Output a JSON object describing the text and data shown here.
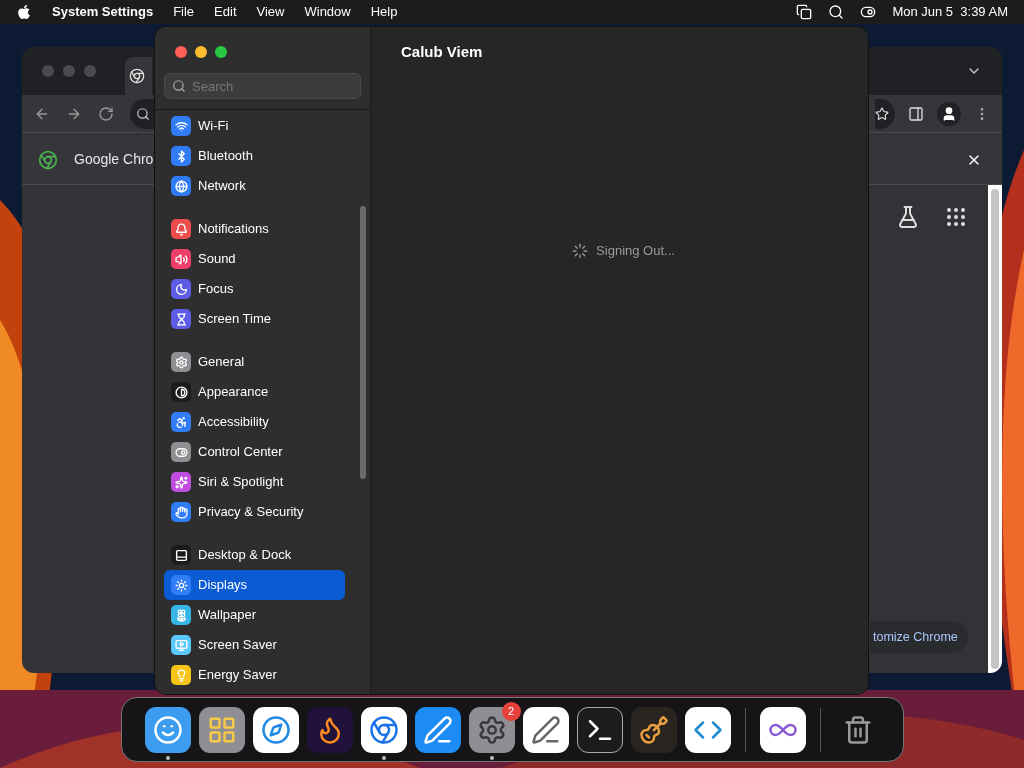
{
  "menu_bar": {
    "app_name": "System Settings",
    "menus": [
      "File",
      "Edit",
      "View",
      "Window",
      "Help"
    ],
    "clock": "Mon Jun 5  3:39 AM"
  },
  "browser_window": {
    "info_bar_text": "Google Chro",
    "customize_button": "tomize Chrome"
  },
  "settings_window": {
    "search": {
      "placeholder": "Search"
    },
    "sidebar_groups": [
      {
        "items": [
          {
            "label": "Wi-Fi",
            "kind": "wifi",
            "color": "#2f7cf6",
            "selected": false
          },
          {
            "label": "Bluetooth",
            "kind": "bluetooth",
            "color": "#2f7cf6",
            "selected": false
          },
          {
            "label": "Network",
            "kind": "globe",
            "color": "#2f7cf6",
            "selected": false
          }
        ]
      },
      {
        "items": [
          {
            "label": "Notifications",
            "kind": "bell",
            "color": "#ee4c4c",
            "selected": false
          },
          {
            "label": "Sound",
            "kind": "speaker",
            "color": "#ee3f6a",
            "selected": false
          },
          {
            "label": "Focus",
            "kind": "moon",
            "color": "#5e5ce6",
            "selected": false
          },
          {
            "label": "Screen Time",
            "kind": "hourglass",
            "color": "#5e5ce6",
            "selected": false
          }
        ]
      },
      {
        "items": [
          {
            "label": "General",
            "kind": "gear",
            "color": "#8e8e93",
            "selected": false
          },
          {
            "label": "Appearance",
            "kind": "contrast",
            "color": "#1c1c1e",
            "selected": false
          },
          {
            "label": "Accessibility",
            "kind": "accessibility",
            "color": "#2f7cf6",
            "selected": false
          },
          {
            "label": "Control Center",
            "kind": "toggles",
            "color": "#8e8e93",
            "selected": false
          },
          {
            "label": "Siri & Spotlight",
            "kind": "sparkles",
            "color": "#c04ce0",
            "selected": false
          },
          {
            "label": "Privacy & Security",
            "kind": "hand",
            "color": "#2f7cf6",
            "selected": false
          }
        ]
      },
      {
        "items": [
          {
            "label": "Desktop & Dock",
            "kind": "dock",
            "color": "#1c1c1e",
            "selected": false
          },
          {
            "label": "Displays",
            "kind": "sun",
            "color": "#2f7cf6",
            "selected": true
          },
          {
            "label": "Wallpaper",
            "kind": "flower",
            "color": "#36b6e6",
            "selected": false
          },
          {
            "label": "Screen Saver",
            "kind": "screen",
            "color": "#5ac8fa",
            "selected": false
          },
          {
            "label": "Energy Saver",
            "kind": "bulb",
            "color": "#f5c518",
            "selected": false
          }
        ]
      }
    ],
    "title": "Calub Viem",
    "status": "Signing Out..."
  },
  "dock": {
    "apps": [
      {
        "kind": "finder",
        "running": true
      },
      {
        "kind": "launchpad",
        "running": false
      },
      {
        "kind": "safari",
        "running": false
      },
      {
        "kind": "firefox",
        "running": false
      },
      {
        "kind": "chrome",
        "running": true
      },
      {
        "kind": "appstore",
        "running": false
      },
      {
        "kind": "settings",
        "running": true,
        "badge": "2"
      },
      {
        "kind": "textedit",
        "running": false
      },
      {
        "kind": "terminal",
        "running": false
      },
      {
        "kind": "guitar",
        "running": false
      },
      {
        "kind": "vscode",
        "running": false
      },
      {
        "kind": "separator"
      },
      {
        "kind": "visualstudio",
        "running": false
      },
      {
        "kind": "separator"
      },
      {
        "kind": "trash",
        "running": false
      }
    ]
  }
}
